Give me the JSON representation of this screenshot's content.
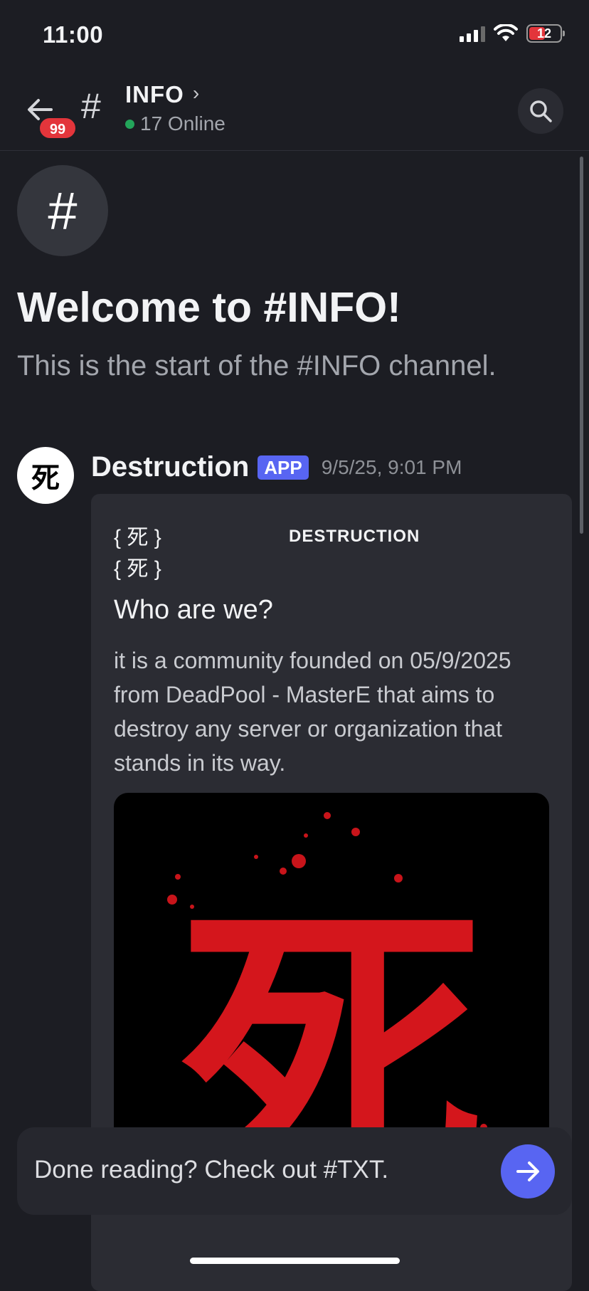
{
  "status_bar": {
    "time": "11:00",
    "battery": "12"
  },
  "header": {
    "back_badge": "99",
    "hash": "#",
    "channel_name": "INFO",
    "online_text": "17 Online"
  },
  "intro": {
    "icon": "#",
    "welcome": "Welcome to #INFO!",
    "start_text": "This is the start of the #INFO channel."
  },
  "message": {
    "avatar_glyph": "死",
    "author": "Destruction",
    "tag": "APP",
    "timestamp": "9/5/25, 9:01 PM",
    "embed": {
      "line1": "{ 死 }",
      "line2": "{ 死 }",
      "author_name": "DESTRUCTION",
      "title": "Who are we?",
      "description": "it is a community founded on 05/9/2025 from DeadPool - MasterE that aims to destroy any server or organization that stands in its way.",
      "image_glyph": "死"
    }
  },
  "composer": {
    "text": "Done reading? Check out #TXT."
  },
  "colors": {
    "accent": "#5865f2",
    "online": "#23a55a",
    "badge": "#e3353b",
    "image_red": "#d4161c"
  }
}
